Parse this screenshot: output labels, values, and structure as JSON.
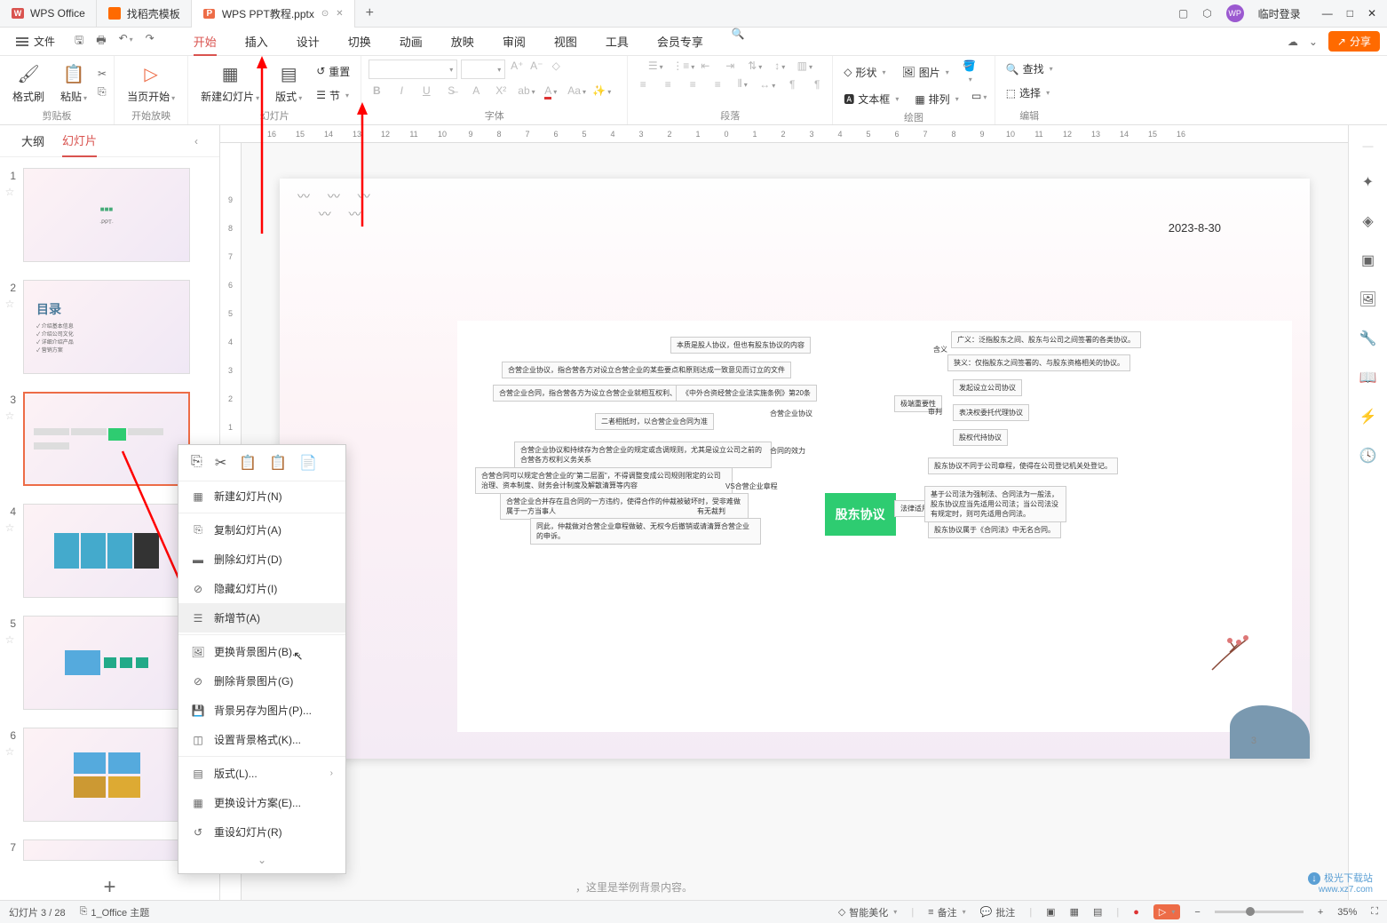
{
  "titlebar": {
    "app_name": "WPS Office",
    "tab_docer": "找稻壳模板",
    "tab_file": "WPS PPT教程.pptx",
    "login_text": "临时登录"
  },
  "menubar": {
    "file": "文件",
    "tabs": [
      "开始",
      "插入",
      "设计",
      "切换",
      "动画",
      "放映",
      "审阅",
      "视图",
      "工具",
      "会员专享"
    ],
    "share": "分享"
  },
  "ribbon": {
    "format_brush": "格式刷",
    "paste": "粘贴",
    "clipboard_label": "剪贴板",
    "play_from": "当页开始",
    "play_label": "开始放映",
    "new_slide": "新建幻灯片",
    "layout": "版式",
    "reset": "重置",
    "section": "节",
    "slides_label": "幻灯片",
    "font_label": "字体",
    "para_label": "段落",
    "shape": "形状",
    "picture": "图片",
    "textbox": "文本框",
    "arrange": "排列",
    "drawing_label": "绘图",
    "find": "查找",
    "select": "选择",
    "edit_label": "编辑"
  },
  "slide_panel": {
    "tab_outline": "大纲",
    "tab_slides": "幻灯片",
    "slides": [
      {
        "num": "1"
      },
      {
        "num": "2",
        "title": "目录",
        "items": [
          "介绍基本信息",
          "介绍公司文化",
          "详细介绍产品",
          "营销方案"
        ]
      },
      {
        "num": "3"
      },
      {
        "num": "4"
      },
      {
        "num": "5"
      },
      {
        "num": "6"
      },
      {
        "num": "7"
      }
    ]
  },
  "context_menu": {
    "new_slide": "新建幻灯片(N)",
    "copy_slide": "复制幻灯片(A)",
    "delete_slide": "删除幻灯片(D)",
    "hide_slide": "隐藏幻灯片(I)",
    "add_section": "新增节(A)",
    "change_bg": "更换背景图片(B)...",
    "delete_bg": "删除背景图片(G)",
    "save_bg": "背景另存为图片(P)...",
    "bg_format": "设置背景格式(K)...",
    "layout": "版式(L)...",
    "change_design": "更换设计方案(E)...",
    "reset_slide": "重设幻灯片(R)"
  },
  "canvas": {
    "date": "2023-8-30",
    "center_node": "股东协议",
    "nodes_left": [
      "本质是股人协议，但也有股东协议的内容",
      "合营企业协议，指合营各方对设立合营企业的某些要点和原则达成一致意见而订立的文件",
      "合营企业合同，指合营各方为设立合营企业就相互权利、义务关系达成一致意见而订立的文件",
      "二者相抵时，以合营企业合同为准",
      "《中外合资经营企业法实施条例》第20条",
      "合营企业协议",
      "合营合同可以规定合营企业的\"第二层面\"，不得调整变成公司规则限定的公司治理、资本制度、财务会计制度及解散清算等内容",
      "合营企业协议和持续存为合营企业的规定或含调规则，尤其是设立公司之前的合营各方权利义务关系",
      "合营企业合并存在且合同的一方违约，使得合作的仲裁被破坏时，受非难做属于一方当事人",
      "VS合营企业章程",
      "同此，仲裁做对合营企业章程做破、无权今后撤销或请清算合营企业的申诉。",
      "有无裁判",
      "合同的效力"
    ],
    "nodes_right": [
      "含义",
      "广义：泛指股东之间、股东与公司之间签署的各类协议。",
      "狭义：仅指股东之间签署的、与股东资格相关的协议。",
      "极端重要性",
      "发起设立公司协议",
      "表决权委托代理协议",
      "审判",
      "股权代持协议",
      "股东协议不同于公司章程，使得在公司登记机关处登记。",
      "法律适用",
      "基于公司法为强制法、合同法为一般法，股东协议应当先适用公司法；当公司法没有规定时，则可先适用合同法。",
      "股东协议属于《合同法》中无名合同。"
    ],
    "page_num": "3"
  },
  "ruler_h": [
    "16",
    "15",
    "14",
    "13",
    "12",
    "11",
    "10",
    "9",
    "8",
    "7",
    "6",
    "5",
    "4",
    "3",
    "2",
    "1",
    "0",
    "1",
    "2",
    "3",
    "4",
    "5",
    "6",
    "7",
    "8",
    "9",
    "10",
    "11",
    "12",
    "13",
    "14",
    "15",
    "16"
  ],
  "ruler_v": [
    "9",
    "8",
    "7",
    "6",
    "5",
    "4",
    "3",
    "2",
    "1",
    "0",
    "1",
    "2",
    "3",
    "4",
    "5",
    "6",
    "7",
    "8",
    "9"
  ],
  "notes_hint": "，这里是举例背景内容。",
  "statusbar": {
    "slide_pos": "幻灯片 3 / 28",
    "theme": "1_Office 主题",
    "beautify": "智能美化",
    "notes": "备注",
    "comments": "批注",
    "zoom": "35%"
  },
  "watermark": {
    "text": "极光下载站",
    "url": "www.xz7.com"
  }
}
